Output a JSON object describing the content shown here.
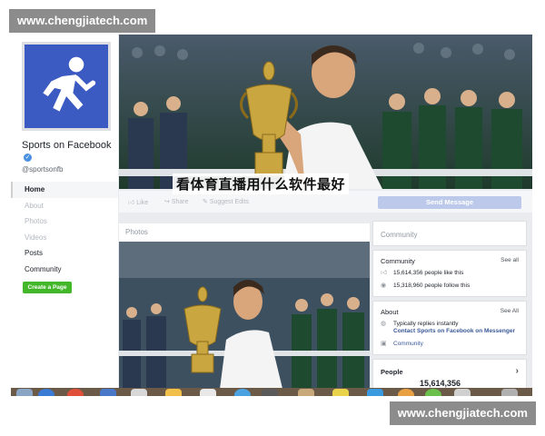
{
  "watermark": {
    "top": "www.chengjiatech.com",
    "bottom": "www.chengjiatech.com"
  },
  "overlay_caption": "看体育直播用什么软件最好",
  "sidebar": {
    "page_name": "Sports on Facebook",
    "handle": "@sportsonfb",
    "profile_icon": "running-person-icon",
    "nav": [
      {
        "label": "Home",
        "state": "active"
      },
      {
        "label": "About",
        "state": "faded"
      },
      {
        "label": "Photos",
        "state": "faded"
      },
      {
        "label": "Videos",
        "state": "faded"
      },
      {
        "label": "Posts",
        "state": "normal"
      },
      {
        "label": "Community",
        "state": "normal"
      }
    ],
    "create_page_label": "Create a Page"
  },
  "action_bar": {
    "like": "Like",
    "share": "Share",
    "suggest": "Suggest Edits",
    "send_message": "Send Message"
  },
  "main": {
    "photos_label": "Photos"
  },
  "right": {
    "community_header": "Community",
    "community_card": {
      "title": "Community",
      "see_all": "See all",
      "likes": "15,614,356 people like this",
      "follows": "15,318,960 people follow this"
    },
    "about_card": {
      "title": "About",
      "see_all": "See All",
      "reply_line": "Typically replies instantly",
      "contact_line": "Contact Sports on Facebook on Messenger",
      "category": "Community"
    },
    "people_card": {
      "title": "People",
      "count": "15,614,356"
    }
  },
  "colors": {
    "facebook_blue": "#3b5ac2",
    "create_green": "#42b72a",
    "send_message_blue": "#bcc9ea",
    "tennis_court_green": "#2f4a3a"
  }
}
